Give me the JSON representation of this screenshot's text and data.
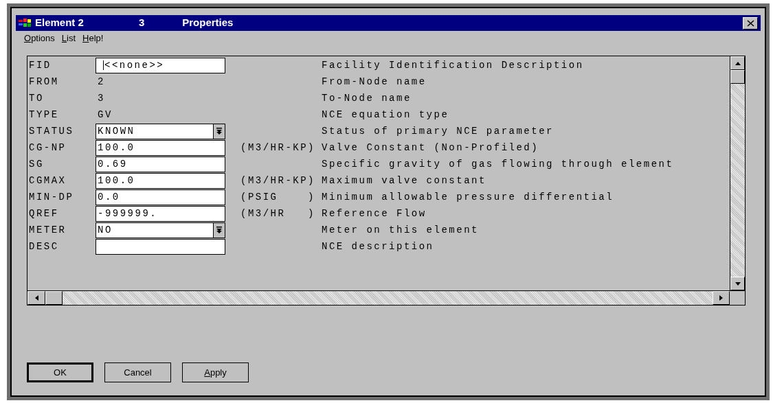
{
  "window": {
    "title_parts": [
      "Element 2",
      "3",
      "Properties"
    ]
  },
  "menu": [
    {
      "label": "Options"
    },
    {
      "label": "List"
    },
    {
      "label": "Help!"
    }
  ],
  "rows": [
    {
      "name": "FID",
      "kind": "input",
      "value": "<<none>>",
      "caret": true,
      "unit": "",
      "description": "Facility Identification Description"
    },
    {
      "name": "FROM",
      "kind": "text",
      "value": "2",
      "unit": "",
      "description": "From-Node name"
    },
    {
      "name": "TO",
      "kind": "text",
      "value": "3",
      "unit": "",
      "description": "To-Node name"
    },
    {
      "name": "TYPE",
      "kind": "text",
      "value": "GV",
      "unit": "",
      "description": "NCE equation type"
    },
    {
      "name": "STATUS",
      "kind": "select",
      "value": "KNOWN",
      "unit": "",
      "description": "Status of primary NCE parameter"
    },
    {
      "name": "CG-NP",
      "kind": "input",
      "value": "100.0",
      "unit": "(M3/HR-KP)",
      "description": "Valve Constant (Non-Profiled)"
    },
    {
      "name": "SG",
      "kind": "input",
      "value": "0.69",
      "unit": "",
      "description": "Specific gravity of gas flowing through element"
    },
    {
      "name": "CGMAX",
      "kind": "input",
      "value": "100.0",
      "unit": "(M3/HR-KP)",
      "description": "Maximum valve constant"
    },
    {
      "name": "MIN-DP",
      "kind": "input",
      "value": "0.0",
      "unit": "(PSIG    )",
      "description": "Minimum allowable pressure differential"
    },
    {
      "name": "QREF",
      "kind": "input",
      "value": "-999999.",
      "unit": "(M3/HR   )",
      "description": "Reference Flow"
    },
    {
      "name": "METER",
      "kind": "select",
      "value": "NO",
      "unit": "",
      "description": "Meter on this element"
    },
    {
      "name": "DESC",
      "kind": "input",
      "value": "",
      "unit": "",
      "description": "NCE description"
    }
  ],
  "buttons": [
    {
      "label": "OK",
      "default": true,
      "underline_first": false
    },
    {
      "label": "Cancel",
      "default": false,
      "underline_first": false
    },
    {
      "label": "Apply",
      "default": false,
      "underline_first": true
    }
  ]
}
